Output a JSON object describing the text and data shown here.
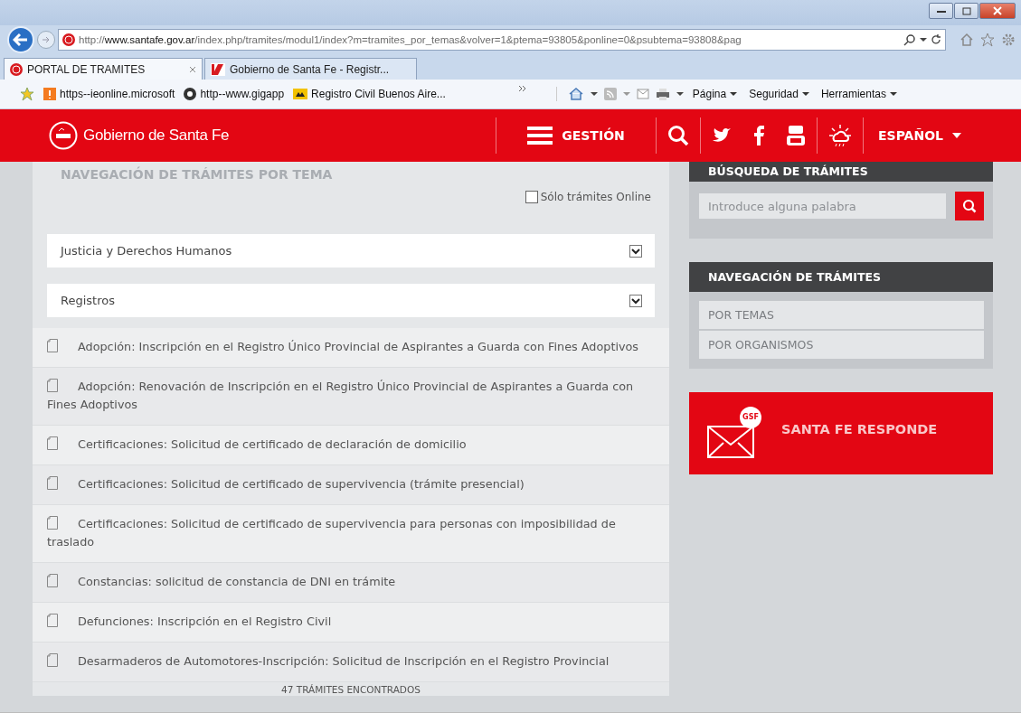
{
  "browser": {
    "url_prefix": "http://",
    "url_domain": "www.santafe.gov.ar",
    "url_rest": "/index.php/tramites/modul1/index?m=tramites_por_temas&volver=1&ptema=93805&ponline=0&psubtema=93808&pag",
    "tabs": [
      {
        "label": "PORTAL DE TRAMITES",
        "selected": true
      },
      {
        "label": "Gobierno de Santa Fe - Registr...",
        "selected": false
      }
    ],
    "favorites": [
      "https--ieonline.microsoft",
      "http--www.gigapp",
      "Registro Civil  Buenos Aire..."
    ],
    "commands": [
      "Página",
      "Seguridad",
      "Herramientas"
    ]
  },
  "header": {
    "brand": "Gobierno de Santa Fe",
    "menu": "GESTIÓN",
    "language": "ESPAÑOL"
  },
  "main": {
    "title": "NAVEGACIÓN DE TRÁMITES POR TEMA",
    "online_filter": {
      "label": "Sólo trámites Online",
      "checked": false
    },
    "filters": [
      "Justicia y Derechos Humanos",
      "Registros"
    ],
    "items": [
      "Adopción: Inscripción en el Registro Único Provincial de Aspirantes a Guarda con Fines Adoptivos",
      "Adopción: Renovación de Inscripción en el Registro Único Provincial de Aspirantes a Guarda con Fines Adoptivos",
      "Certificaciones: Solicitud de certificado de declaración de domicilio",
      "Certificaciones: Solicitud de certificado de supervivencia (trámite presencial)",
      "Certificaciones: Solicitud de certificado de supervivencia para personas con imposibilidad de traslado",
      "Constancias: solicitud de constancia de DNI en trámite",
      "Defunciones: Inscripción en el Registro Civil",
      "Desarmaderos de Automotores-Inscripción: Solicitud de Inscripción en el Registro Provincial"
    ],
    "count": "47 TRÁMITES ENCONTRADOS"
  },
  "sidebar": {
    "search": {
      "title": "BÚSQUEDA DE TRÁMITES",
      "placeholder": "Introduce alguna palabra"
    },
    "navigation": {
      "title": "NAVEGACIÓN DE TRÁMITES",
      "links": [
        "POR TEMAS",
        "POR ORGANISMOS"
      ]
    },
    "promo": {
      "label": "SANTA FE RESPONDE",
      "badge": "GSF"
    }
  }
}
